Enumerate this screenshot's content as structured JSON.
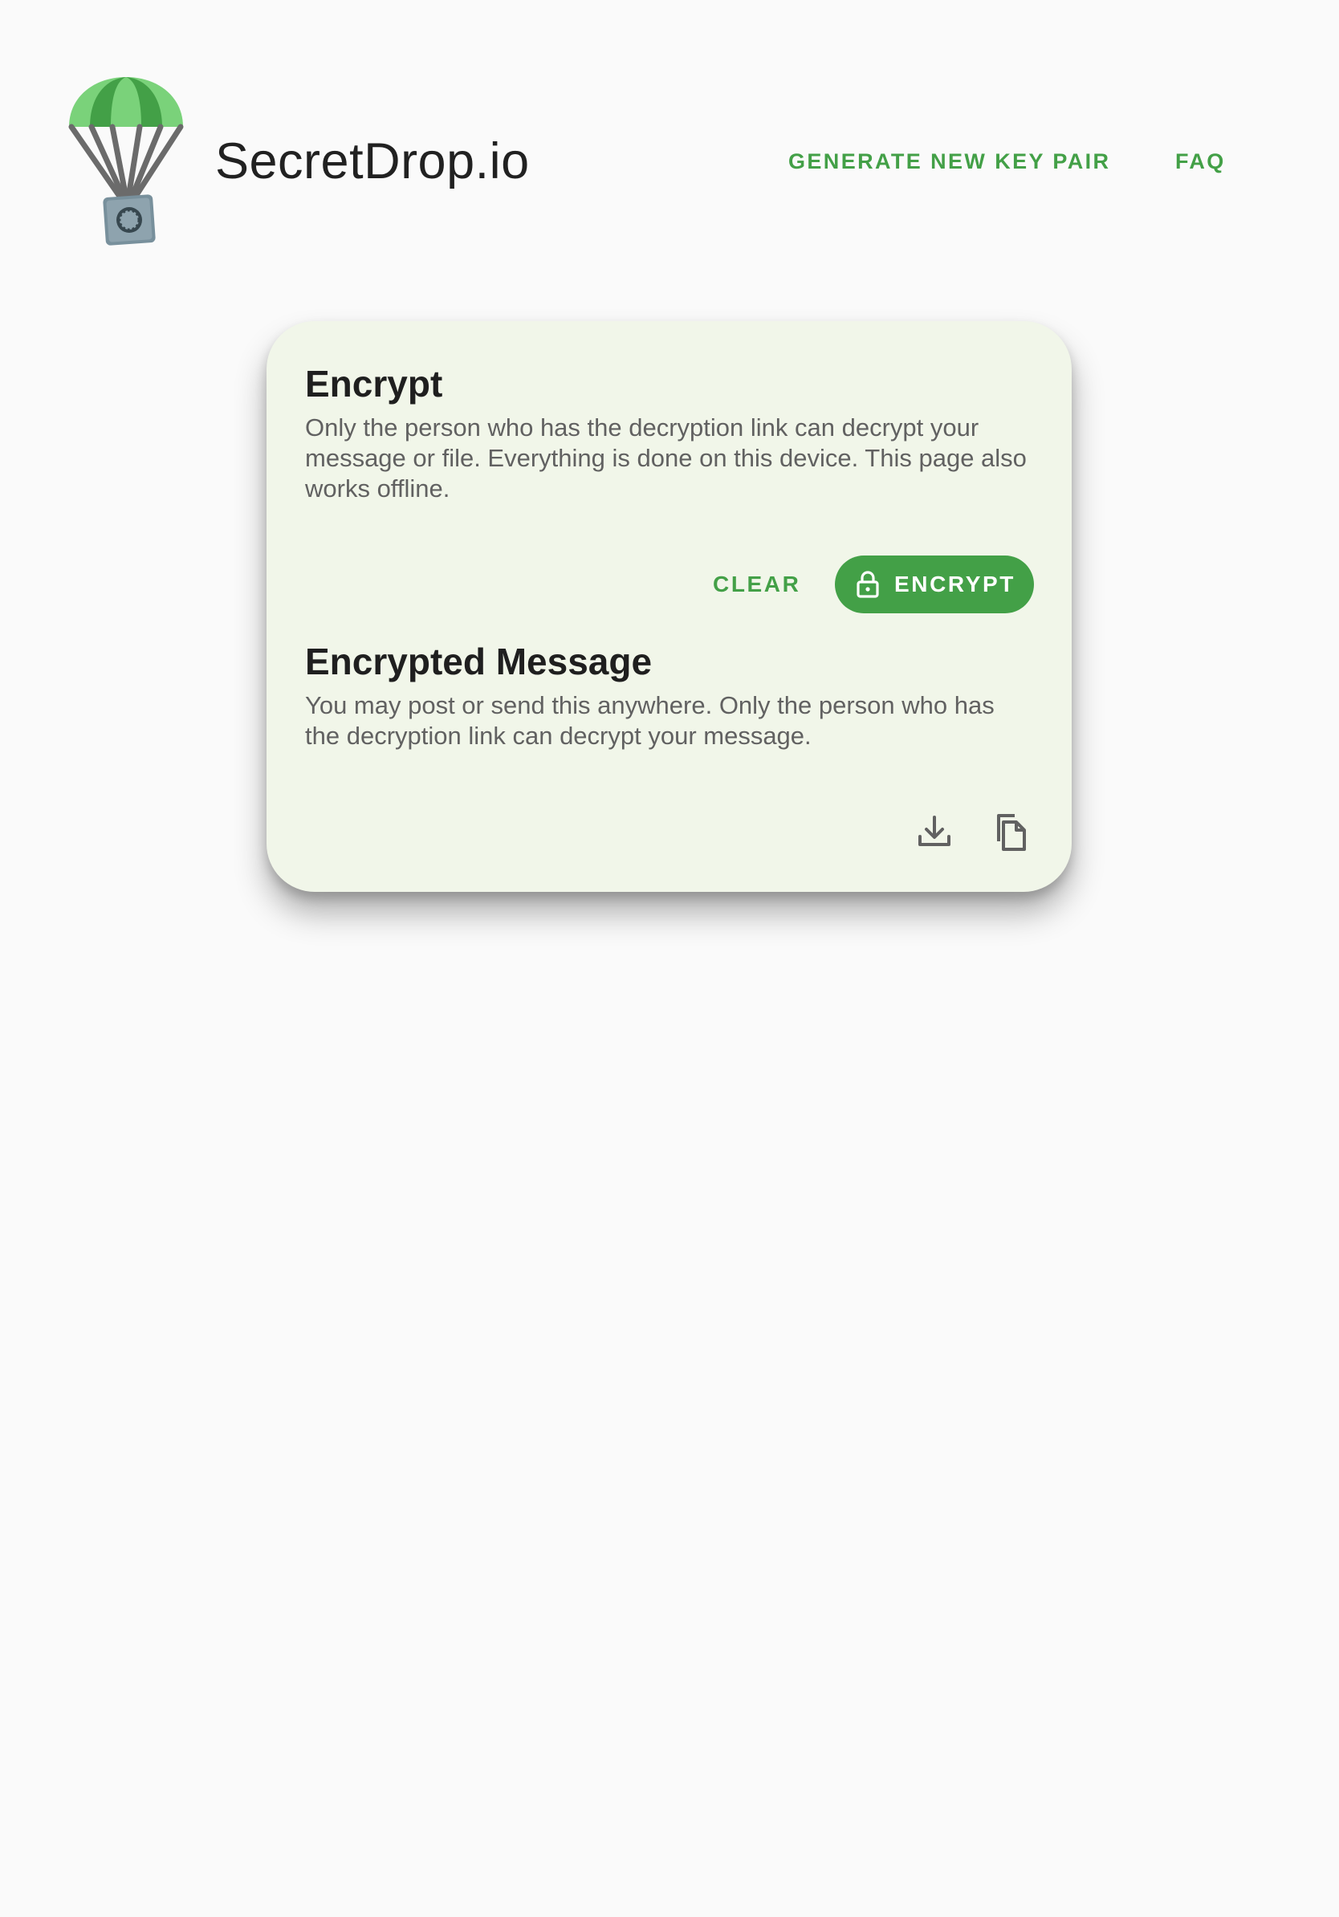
{
  "header": {
    "logo_icon": "parachute-safe-logo-icon",
    "title": "SecretDrop.io",
    "nav": {
      "generate_label": "GENERATE NEW KEY PAIR",
      "faq_label": "FAQ"
    }
  },
  "card": {
    "encrypt": {
      "title": "Encrypt",
      "description": "Only the person who has the decryption link can decrypt your message or file. Everything is done on this device. This page also works offline.",
      "clear_label": "CLEAR",
      "encrypt_label": "ENCRYPT",
      "encrypt_icon": "lock-icon"
    },
    "encrypted_message": {
      "title": "Encrypted Message",
      "description": "You may post or send this anywhere. Only the person who has the decryption link can decrypt your message.",
      "download_icon": "download-icon",
      "copy_icon": "copy-icon"
    }
  },
  "colors": {
    "accent": "#43a047",
    "background": "#fafafa",
    "card_background": "#f1f6e9",
    "text_primary": "#1f1f1f",
    "text_secondary": "#616161"
  }
}
